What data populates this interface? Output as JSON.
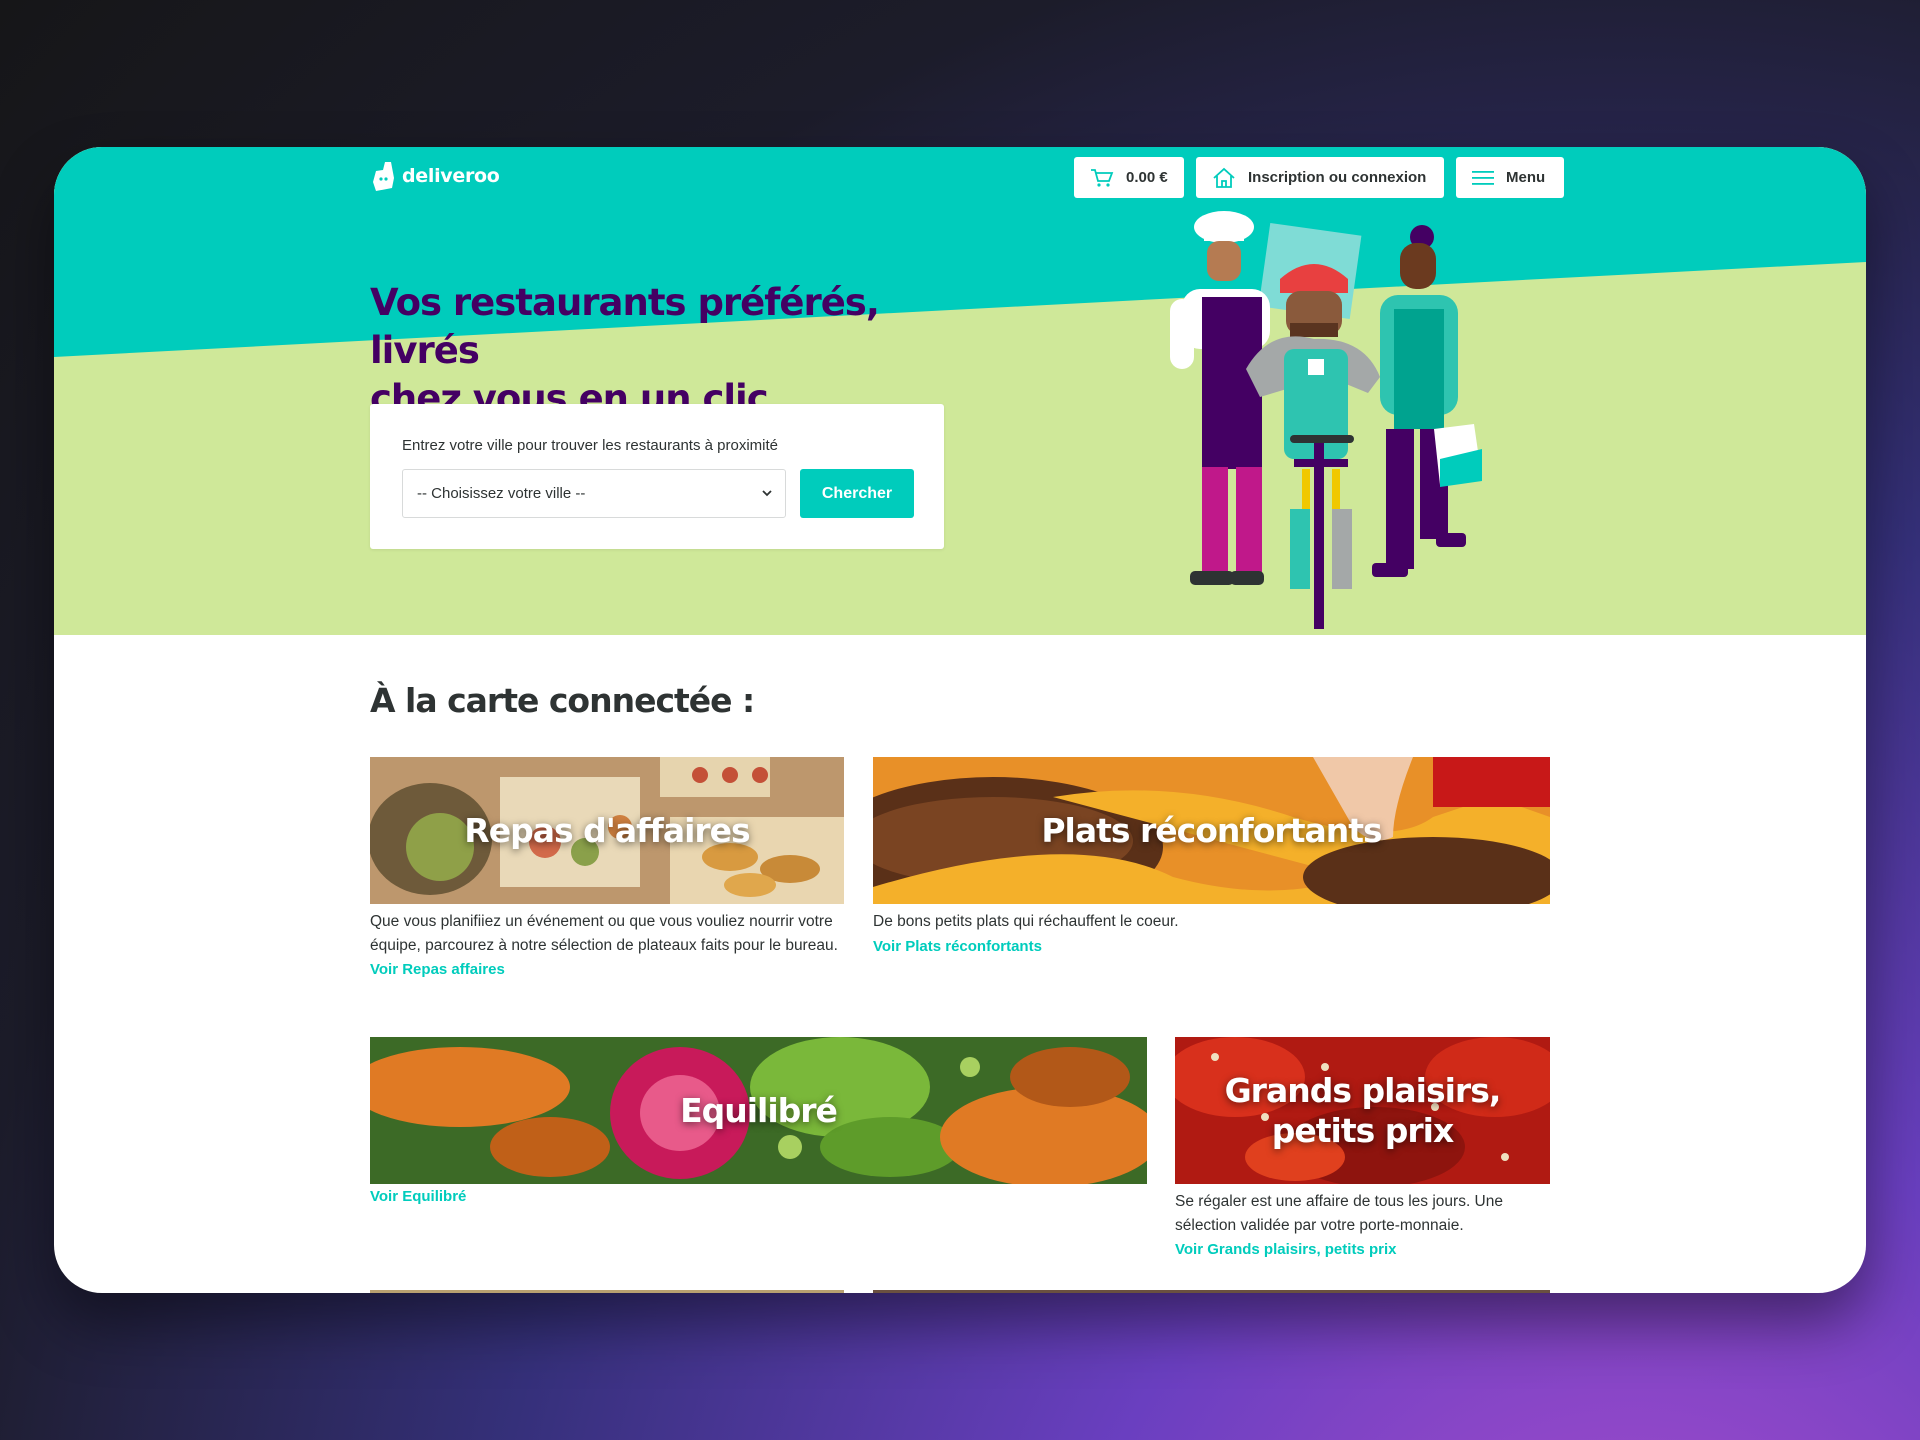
{
  "brand": {
    "name": "deliveroo",
    "color": "#00ccbc",
    "accent": "#440063"
  },
  "header": {
    "cart_total": "0.00 €",
    "login_label": "Inscription ou connexion",
    "menu_label": "Menu"
  },
  "hero": {
    "title_line1": "Vos restaurants préférés, livrés",
    "title_line2": "chez vous en un clic",
    "search_label": "Entrez votre ville pour trouver les restaurants à proximité",
    "city_select_value": "-- Choisissez votre ville --",
    "search_button": "Chercher"
  },
  "collections": {
    "title": "À la carte connectée :",
    "items": [
      {
        "image_title": "Repas d'affaires",
        "description": "Que vous planifiiez un événement ou que vous vouliez nourrir votre équipe, parcourez à notre sélection de plateaux faits pour le bureau.",
        "link": "Voir Repas affaires"
      },
      {
        "image_title": "Plats réconfortants",
        "description": "De bons petits plats qui réchauffent le coeur.",
        "link": "Voir Plats réconfortants"
      },
      {
        "image_title": "Equilibré",
        "description": "",
        "link": "Voir Equilibré"
      },
      {
        "image_title": "Grands plaisirs, petits prix",
        "description": "Se régaler est une affaire de tous les jours. Une sélection validée par votre porte-monnaie.",
        "link": "Voir Grands plaisirs, petits prix"
      }
    ]
  },
  "icons": [
    "deliveroo-logo-icon",
    "cart-icon",
    "home-icon",
    "hamburger-menu-icon",
    "chevron-down-icon"
  ]
}
